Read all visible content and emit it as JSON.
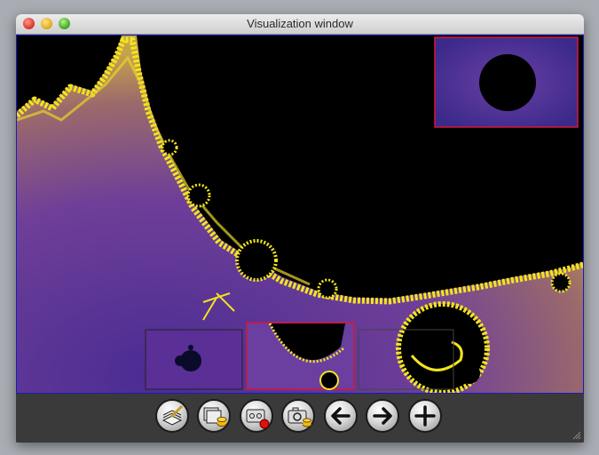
{
  "window": {
    "title": "Visualization window"
  },
  "colors": {
    "fractal_black": "#000000",
    "fractal_purple": "#5a2c8c",
    "fractal_yellow": "#f2e51c",
    "selection_border": "#d4173a",
    "canvas_border": "#1c1cb8"
  },
  "icons": [
    "close-icon",
    "minimize-icon",
    "zoom-icon",
    "paint-brush-icon",
    "layers-save-icon",
    "record-icon",
    "camera-save-icon",
    "arrow-left-icon",
    "arrow-right-icon",
    "plus-icon"
  ]
}
